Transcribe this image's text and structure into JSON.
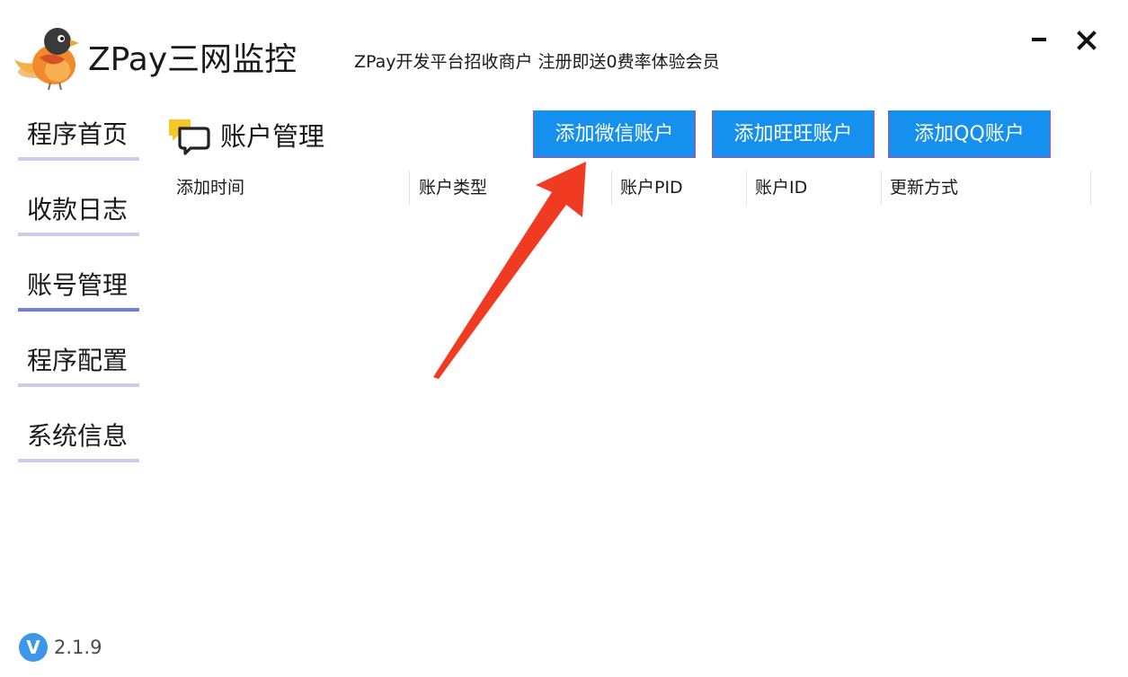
{
  "app": {
    "title": "ZPay三网监控",
    "promo_text": "ZPay开发平台招收商户 注册即送0费率体验会员",
    "logo_icon": "bird-logo-icon"
  },
  "window_controls": {
    "minimize_icon": "minimize-icon",
    "close_icon": "close-icon"
  },
  "sidebar": {
    "items": [
      {
        "label": "程序首页",
        "active": false
      },
      {
        "label": "收款日志",
        "active": false
      },
      {
        "label": "账号管理",
        "active": true
      },
      {
        "label": "程序配置",
        "active": false
      },
      {
        "label": "系统信息",
        "active": false
      }
    ]
  },
  "section": {
    "title": "账户管理",
    "icon": "chat-bubbles-icon"
  },
  "actions": {
    "add_wechat": "添加微信账户",
    "add_wangwang": "添加旺旺账户",
    "add_qq": "添加QQ账户"
  },
  "table": {
    "columns": [
      "添加时间",
      "账户类型",
      "账户PID",
      "账户ID",
      "更新方式"
    ],
    "rows": []
  },
  "version": {
    "badge_letter": "V",
    "number": "2.1.9"
  },
  "colors": {
    "accent": "#1590ee",
    "nav_underline": "#c8cdef",
    "nav_underline_active": "#6f7fe3",
    "annotation": "#f03a22"
  }
}
